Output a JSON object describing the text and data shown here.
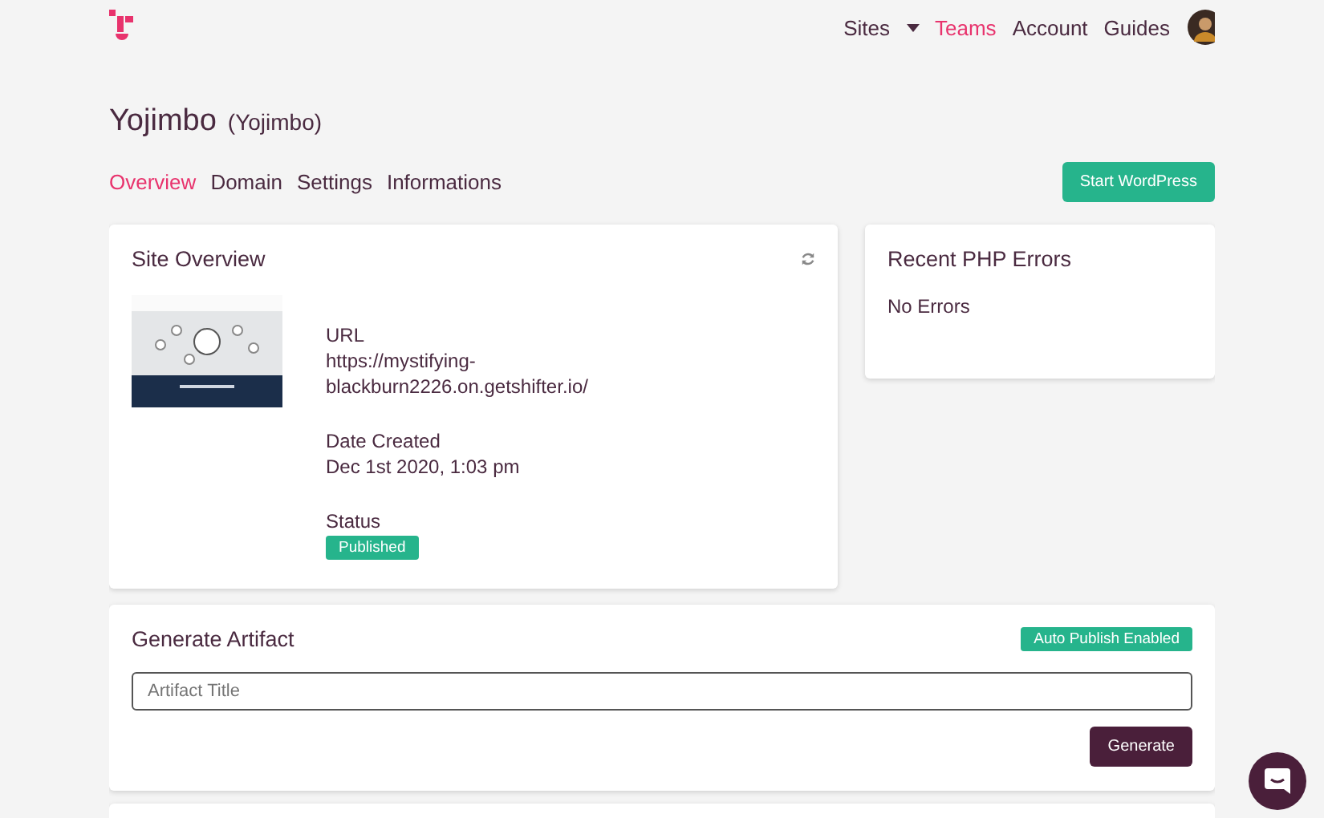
{
  "nav": {
    "items": [
      {
        "label": "Sites",
        "selected": false,
        "dropdown": true
      },
      {
        "label": "Teams",
        "selected": true,
        "dropdown": false
      },
      {
        "label": "Account",
        "selected": false,
        "dropdown": false
      },
      {
        "label": "Guides",
        "selected": false,
        "dropdown": false
      }
    ]
  },
  "site": {
    "name": "Yojimbo",
    "subtitle": "(Yojimbo)"
  },
  "tabs": [
    {
      "label": "Overview",
      "selected": true
    },
    {
      "label": "Domain",
      "selected": false
    },
    {
      "label": "Settings",
      "selected": false
    },
    {
      "label": "Informations",
      "selected": false
    }
  ],
  "start_button": "Start WordPress",
  "overview": {
    "title": "Site Overview",
    "fields": [
      {
        "label": "URL",
        "value": "https://mystifying-blackburn2226.on.getshifter.io/",
        "kind": "text"
      },
      {
        "label": "Date Created",
        "value": "Dec 1st 2020, 1:03 pm",
        "kind": "text"
      },
      {
        "label": "Status",
        "value": "Published",
        "kind": "badge"
      }
    ]
  },
  "errors": {
    "title": "Recent PHP Errors",
    "message": "No Errors"
  },
  "artifact": {
    "title": "Generate Artifact",
    "badge": "Auto Publish Enabled",
    "placeholder": "Artifact Title",
    "button": "Generate"
  }
}
